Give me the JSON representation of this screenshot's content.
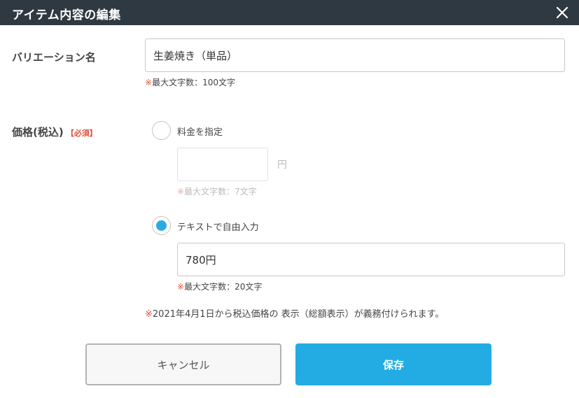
{
  "dialog": {
    "title": "アイテム内容の編集",
    "close_icon": "close-icon"
  },
  "variation": {
    "label": "バリエーション名",
    "value": "生姜焼き（単品）",
    "hint_mark": "※",
    "hint": "最大文字数：100文字"
  },
  "price": {
    "label": "価格(税込)",
    "required": "【必須】",
    "option_fixed": {
      "label": "料金を指定",
      "selected": false,
      "value": "",
      "unit": "円",
      "hint_mark": "※",
      "hint": "最大文字数：7文字"
    },
    "option_text": {
      "label": "テキストで自由入力",
      "selected": true,
      "value": "780円",
      "hint_mark": "※",
      "hint": "最大文字数：20文字"
    },
    "notice_mark": "※",
    "notice": "2021年4月1日から税込価格の 表示（総額表示）が義務付けられます。"
  },
  "buttons": {
    "cancel": "キャンセル",
    "save": "保存"
  },
  "colors": {
    "header_bg": "#2f3941",
    "accent": "#22ace3",
    "required": "#e0533d"
  }
}
